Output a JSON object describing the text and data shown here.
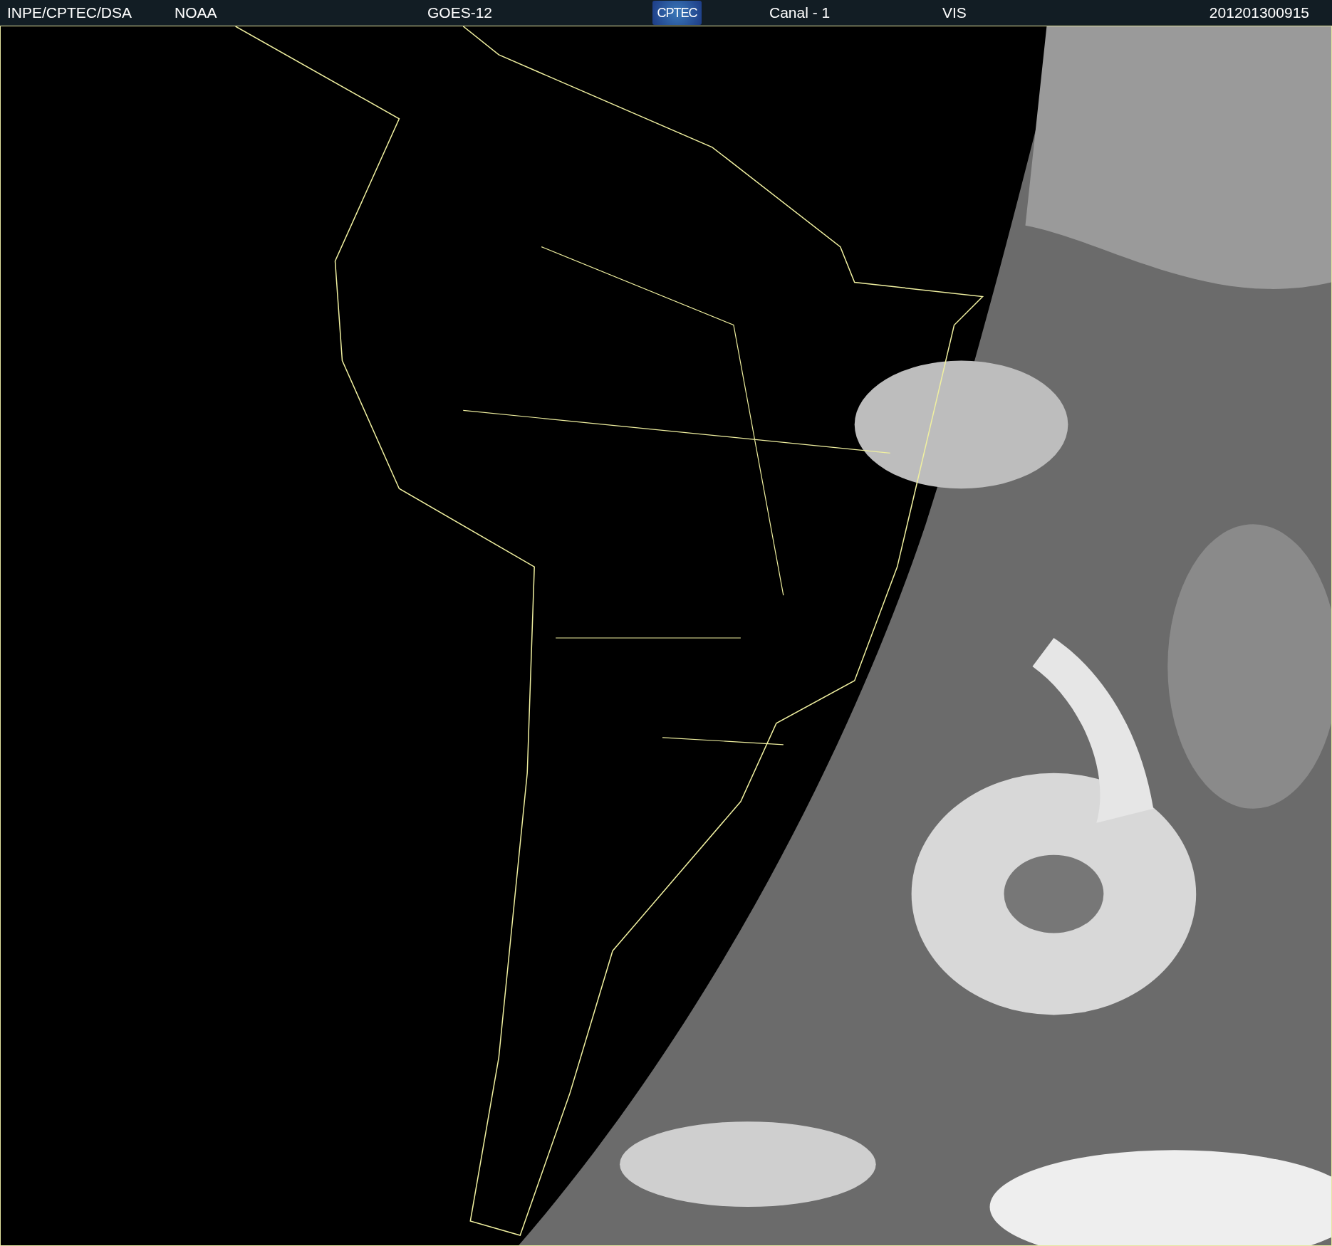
{
  "header": {
    "source": "INPE/CPTEC/DSA",
    "agency": "NOAA",
    "satellite": "GOES-12",
    "logo": "CPTEC",
    "channel": "Canal - 1",
    "band": "VIS",
    "timestamp": "201201300915"
  }
}
